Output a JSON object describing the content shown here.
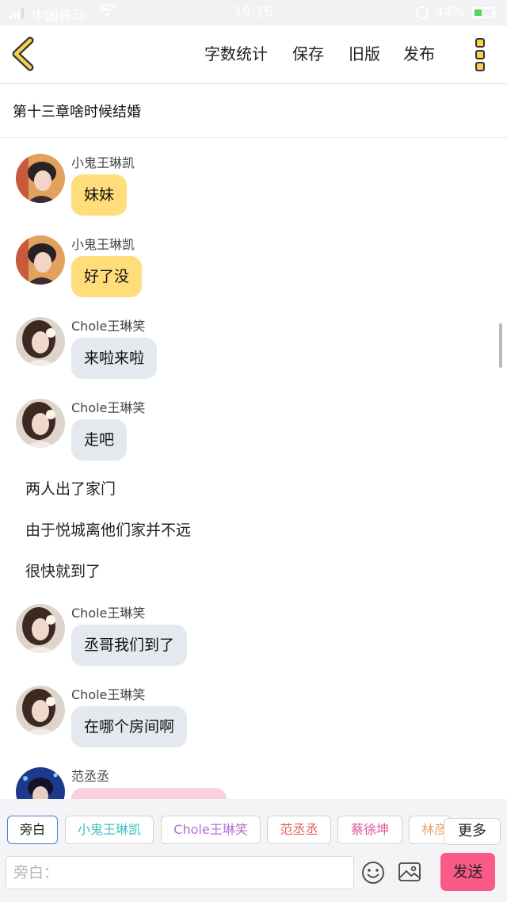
{
  "status_bar": {
    "carrier": "中国移动",
    "time": "19:16",
    "battery": "44%"
  },
  "nav": {
    "word_count": "字数统计",
    "save": "保存",
    "old_version": "旧版",
    "publish": "发布"
  },
  "chapter": {
    "title": "第十三章啥时候结婚"
  },
  "messages": [
    {
      "sender": "小鬼王琳凯",
      "text": "妹妹"
    },
    {
      "sender": "小鬼王琳凯",
      "text": "好了没"
    },
    {
      "sender": "Chole王琳笑",
      "text": "来啦来啦"
    },
    {
      "sender": "Chole王琳笑",
      "text": "走吧"
    },
    {
      "sender": "Chole王琳笑",
      "text": "丞哥我们到了"
    },
    {
      "sender": "Chole王琳笑",
      "text": "在哪个房间啊"
    },
    {
      "sender": "范丞丞",
      "text": ""
    }
  ],
  "narration": [
    "两人出了家门",
    "由于悦城离他们家并不远",
    "很快就到了"
  ],
  "role_chips": [
    {
      "label": "旁白",
      "color": "#222222"
    },
    {
      "label": "小鬼王琳凯",
      "color": "#3cc3c3"
    },
    {
      "label": "Chole王琳笑",
      "color": "#b66fcf"
    },
    {
      "label": "范丞丞",
      "color": "#e05a5a"
    },
    {
      "label": "蔡徐坤",
      "color": "#e0559a"
    },
    {
      "label": "林彦俊",
      "color": "#e8a56e"
    }
  ],
  "more_label": "更多",
  "input": {
    "placeholder": "旁白：",
    "value": ""
  },
  "send_label": "发送",
  "colors": {
    "bubble_yellow": "#fedd7a",
    "bubble_gray": "#e3e9ef",
    "bubble_pink": "#fbd0de",
    "send_button": "#fb5987",
    "accent_icon": "#f6d14f"
  },
  "icons": [
    "back-arrow-icon",
    "more-menu-icon",
    "emoji-icon",
    "image-icon",
    "signal-icon",
    "wifi-icon",
    "battery-icon"
  ]
}
